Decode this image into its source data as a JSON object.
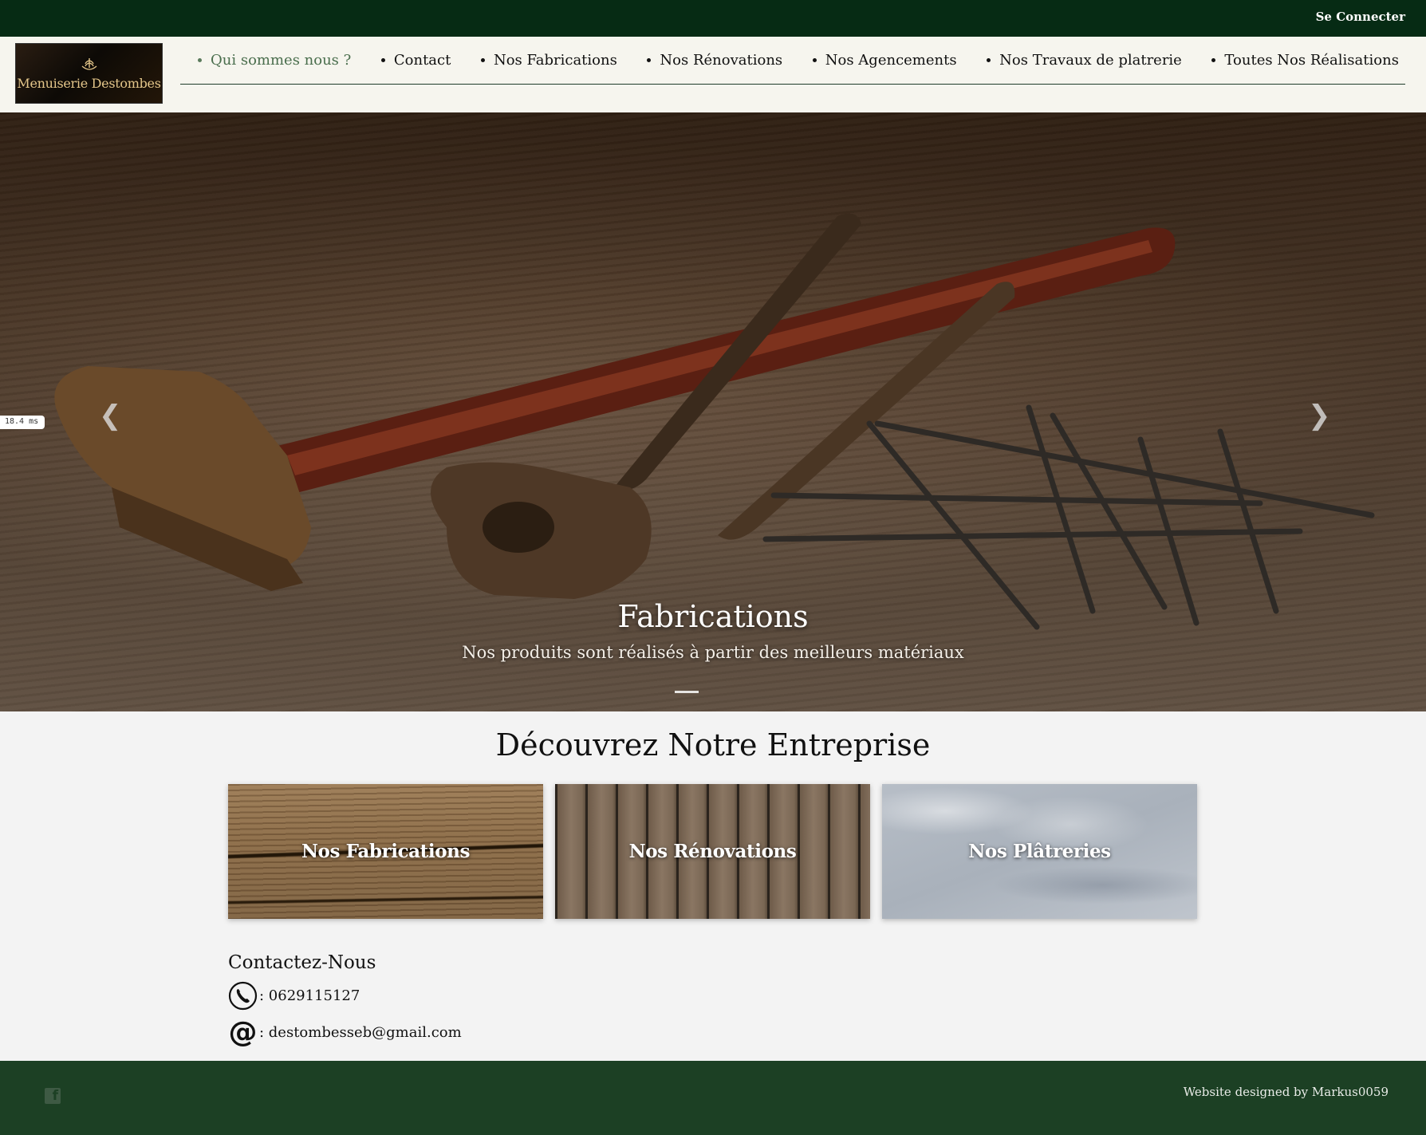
{
  "topbar": {
    "login_label": "Se Connecter"
  },
  "header": {
    "logo_text": "Menuiserie Destombes",
    "nav": [
      {
        "label": "Qui sommes nous ?",
        "active": true
      },
      {
        "label": "Contact"
      },
      {
        "label": "Nos Fabrications"
      },
      {
        "label": "Nos Rénovations"
      },
      {
        "label": "Nos Agencements"
      },
      {
        "label": "Nos Travaux de platrerie"
      },
      {
        "label": "Toutes Nos Réalisations"
      }
    ]
  },
  "hero": {
    "title": "Fabrications",
    "subtitle": "Nos produits sont réalisés à partir des meilleurs matériaux",
    "prev_icon": "chevron-left-icon",
    "next_icon": "chevron-right-icon",
    "timing_badge": "18.4 ms"
  },
  "section": {
    "title": "Découvrez Notre Entreprise",
    "cards": [
      {
        "label": "Nos Fabrications"
      },
      {
        "label": "Nos Rénovations"
      },
      {
        "label": "Nos Plâtreries"
      }
    ]
  },
  "contact": {
    "title": "Contactez-Nous",
    "phone": ": 0629115127",
    "email": ": destombesseb@gmail.com",
    "phone_icon": "phone-icon",
    "email_icon": "at-sign-icon"
  },
  "footer": {
    "credit": "Website designed by Markus0059",
    "social_icon": "facebook-icon"
  },
  "colors": {
    "topbar": "#062b14",
    "header_bg": "#f6f5ee",
    "footer": "#1c4024",
    "active_nav": "#4a6e4d",
    "page_bg": "#f3f3f3"
  }
}
